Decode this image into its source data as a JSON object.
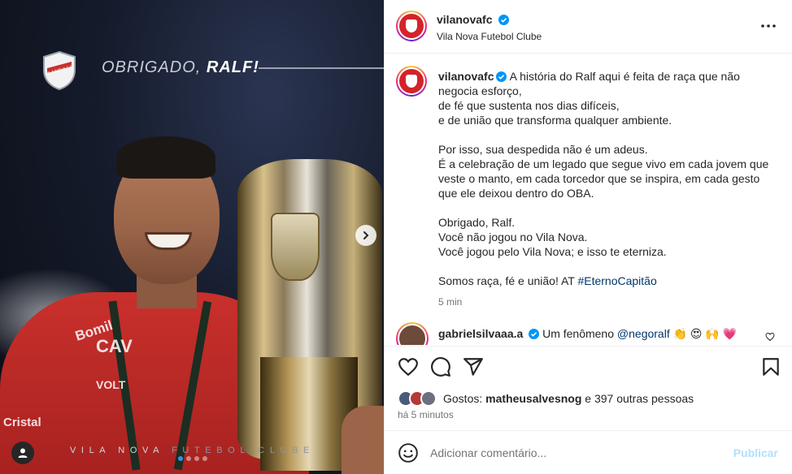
{
  "post_image": {
    "headline_prefix": "OBRIGADO, ",
    "headline_name": "RALF!",
    "footer_club_bold": "VILA NOVA ",
    "footer_club_light": "FUTEBOL CLUBE",
    "shirt_sponsor_1": "Bomil",
    "shirt_sponsor_2": "CAV",
    "shirt_sponsor_3": "VOLT",
    "shirt_sponsor_4": "Cristal",
    "carousel_dots": 4,
    "carousel_active": 0
  },
  "header": {
    "username": "vilanovafc",
    "subtitle": "Vila Nova Futebol Clube"
  },
  "caption": {
    "username": "vilanovafc",
    "line1": "A história do Ralf aqui é feita de raça que não negocia esforço,",
    "line2": "de fé que sustenta nos dias difíceis,",
    "line3": "e de união que transforma qualquer ambiente.",
    "line4": "Por isso, sua despedida não é um adeus.",
    "line5": "É a celebração de um legado que segue vivo em cada jovem que veste o manto, em cada torcedor que se inspira, em cada gesto que ele deixou dentro do OBA.",
    "line6": "Obrigado, Ralf.",
    "line7": "Você não jogou no Vila Nova.",
    "line8": "Você jogou pelo Vila Nova; e isso te eterniza.",
    "line9": "Somos raça, fé e união! AT ",
    "hashtag": "#EternoCapitão",
    "time": "5 min"
  },
  "comment": {
    "username": "gabrielsilvaaa.a",
    "text_prefix": "Um fenômeno ",
    "mention": "@negoralf",
    "emojis": "👏 😍 🙌 💗"
  },
  "likes": {
    "prefix": "Gostos: ",
    "user": "matheusalvesnog",
    "suffix": " e 397 outras pessoas",
    "posted": "há 5 minutos"
  },
  "comment_box": {
    "placeholder": "Adicionar comentário...",
    "publish_label": "Publicar"
  },
  "colors": {
    "brand_red": "#d4232a",
    "link_blue": "#00376b",
    "verified_blue": "#0095f6",
    "publish_disabled": "#b2dffc"
  }
}
